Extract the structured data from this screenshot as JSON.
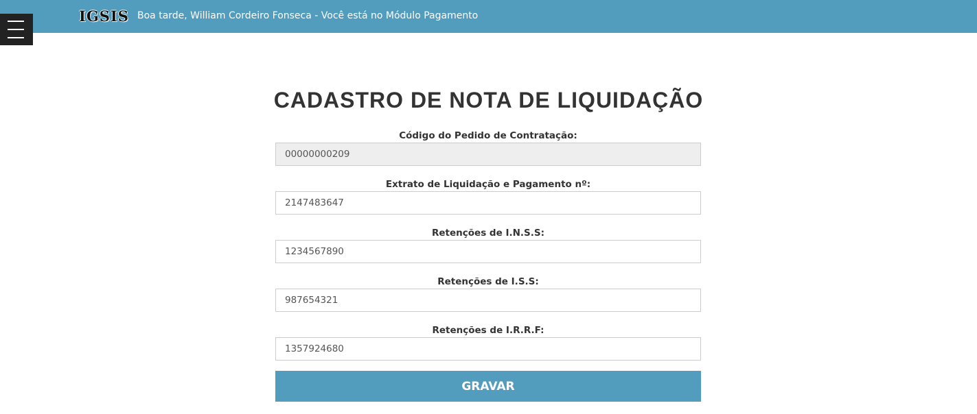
{
  "header": {
    "logo": "IGSIS",
    "greeting": "Boa tarde, William Cordeiro Fonseca - Você está no Módulo Pagamento",
    "bg_color": "#529cbe",
    "menu_icon": "hamburger-menu-icon"
  },
  "page": {
    "title": "CADASTRO DE NOTA DE LIQUIDAÇÃO"
  },
  "form": {
    "fields": [
      {
        "label": "Código do Pedido de Contratação:",
        "value": "00000000209",
        "readonly": true
      },
      {
        "label": "Extrato de Liquidação e Pagamento nº:",
        "value": "2147483647",
        "readonly": false
      },
      {
        "label": "Retenções de I.N.S.S:",
        "value": "1234567890",
        "readonly": false
      },
      {
        "label": "Retenções de I.S.S:",
        "value": "987654321",
        "readonly": false
      },
      {
        "label": "Retenções de I.R.R.F:",
        "value": "1357924680",
        "readonly": false
      }
    ],
    "submit_label": "GRAVAR",
    "submit_color": "#529cbe"
  }
}
